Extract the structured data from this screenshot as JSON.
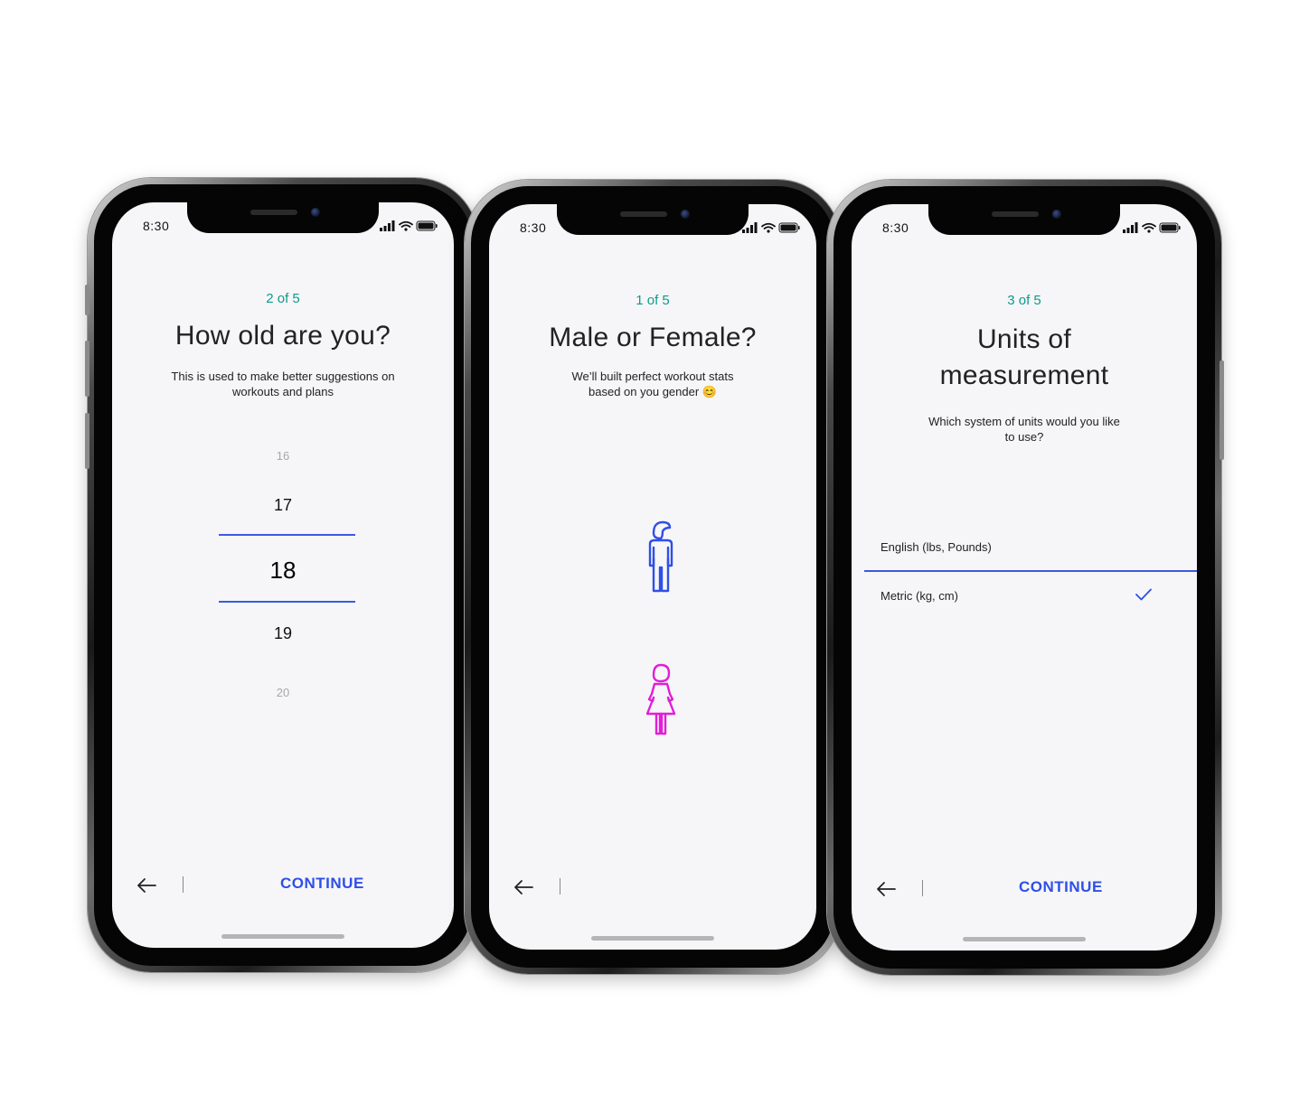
{
  "phones": [
    {
      "time": "8:30",
      "step": "2 of 5",
      "title": "How old are you?",
      "subtitle_line1": "This is used to make better suggestions on",
      "subtitle_line2": "workouts and plans",
      "ages": [
        "16",
        "17",
        "18",
        "19",
        "20"
      ],
      "selected_age": "18",
      "continue_label": "CONTINUE"
    },
    {
      "time": "8:30",
      "step": "1 of 5",
      "title": "Male or Female?",
      "subtitle_line1": "We’ll built perfect workout stats",
      "subtitle_line2": "based on you gender 😊",
      "male_icon": "male-figure-icon",
      "female_icon": "female-figure-icon",
      "male_color": "#2f4fe8",
      "female_color": "#e21ed7"
    },
    {
      "time": "8:30",
      "step": "3 of 5",
      "title_line1": "Units of",
      "title_line2": "measurement",
      "subtitle_line1": "Which system of units would you like",
      "subtitle_line2": "to use?",
      "options": [
        "English (lbs, Pounds)",
        "Metric (kg, cm)"
      ],
      "selected_option": "Metric (kg, cm)",
      "continue_label": "CONTINUE"
    }
  ],
  "colors": {
    "accent": "#2f4fe8",
    "step_teal": "#0f9a8a",
    "female": "#e21ed7",
    "screen_bg": "#f6f6f8"
  }
}
